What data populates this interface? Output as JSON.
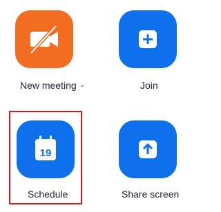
{
  "actions": [
    {
      "id": "new-meeting",
      "label": "New meeting",
      "icon": "video-off-icon",
      "color": "#f26d21",
      "has_dropdown": true
    },
    {
      "id": "join",
      "label": "Join",
      "icon": "plus-icon",
      "color": "#0e71eb"
    },
    {
      "id": "schedule",
      "label": "Schedule",
      "icon": "calendar-icon",
      "calendar_day": "19",
      "color": "#0e71eb",
      "highlighted": true
    },
    {
      "id": "share-screen",
      "label": "Share screen",
      "icon": "share-arrow-icon",
      "color": "#0e71eb"
    }
  ],
  "highlight_color": "#d9161c"
}
